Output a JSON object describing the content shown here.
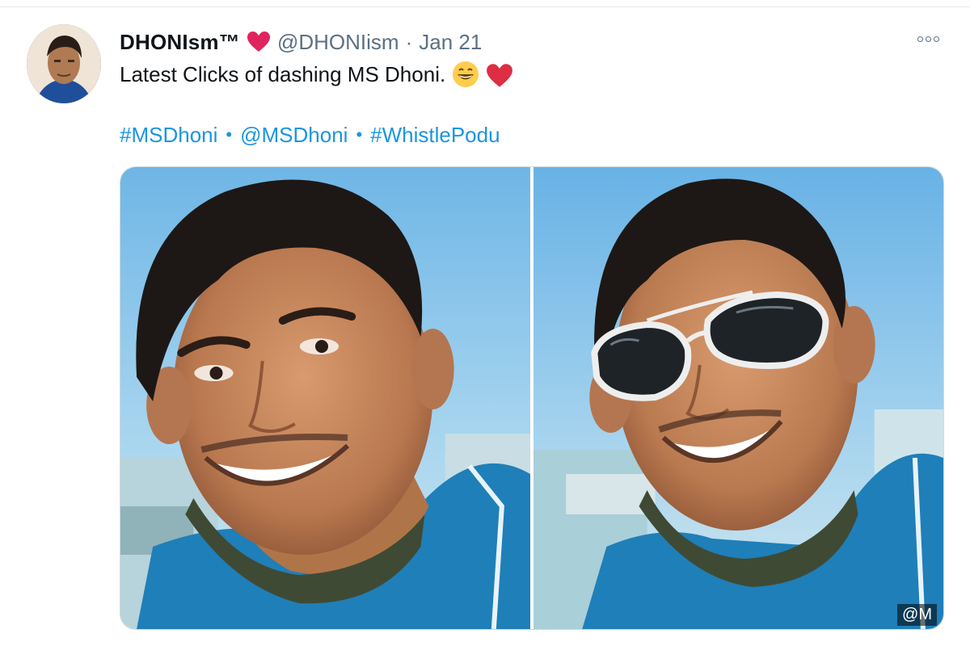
{
  "tweet": {
    "display_name": "DHONIsm™",
    "handle": "@DHONIism",
    "separator": "·",
    "date": "Jan 21",
    "text": "Latest Clicks of dashing MS Dhoni.",
    "emojis": [
      "grinning-face-emoji",
      "red-heart-emoji"
    ],
    "links": [
      {
        "label": "#MSDhoni"
      },
      {
        "label": "@MSDhoni"
      },
      {
        "label": "#WhistlePodu"
      }
    ],
    "link_separator": "•",
    "more_icon": "more-horizontal-icon",
    "media": [
      {
        "name": "photo-smiling"
      },
      {
        "name": "photo-sunglasses",
        "watermark": "@M"
      }
    ]
  },
  "colors": {
    "link": "#1b95e0",
    "secondary_text": "#5b7083",
    "heart": "#e0245e",
    "shirt": "#1f7fb8"
  }
}
